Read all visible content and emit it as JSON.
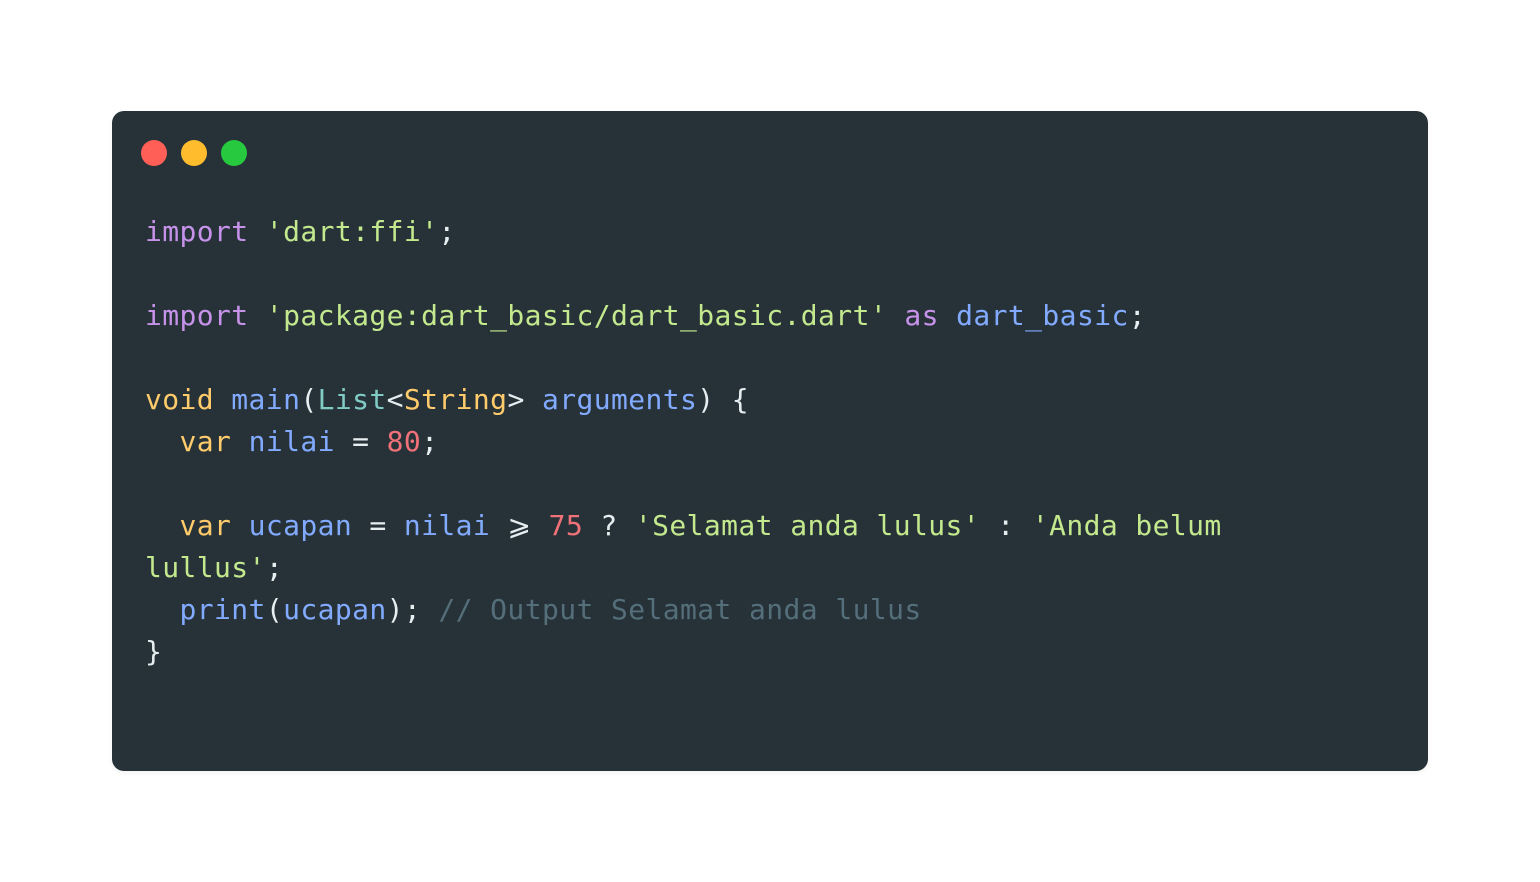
{
  "window": {
    "controls": {
      "close_color": "#ff5f56",
      "minimize_color": "#ffbd2e",
      "maximize_color": "#27c93f"
    }
  },
  "code": {
    "lines": [
      {
        "tokens": [
          {
            "text": "import",
            "kind": "kw"
          },
          {
            "text": " ",
            "kind": "op"
          },
          {
            "text": "'dart:ffi'",
            "kind": "str"
          },
          {
            "text": ";",
            "kind": "op"
          }
        ]
      },
      {
        "tokens": []
      },
      {
        "tokens": [
          {
            "text": "import",
            "kind": "kw"
          },
          {
            "text": " ",
            "kind": "op"
          },
          {
            "text": "'package:dart_basic/dart_basic.dart'",
            "kind": "str"
          },
          {
            "text": " ",
            "kind": "op"
          },
          {
            "text": "as",
            "kind": "kw"
          },
          {
            "text": " ",
            "kind": "op"
          },
          {
            "text": "dart_basic",
            "kind": "var"
          },
          {
            "text": ";",
            "kind": "op"
          }
        ]
      },
      {
        "tokens": []
      },
      {
        "tokens": [
          {
            "text": "void",
            "kind": "type"
          },
          {
            "text": " ",
            "kind": "op"
          },
          {
            "text": "main",
            "kind": "fn"
          },
          {
            "text": "(",
            "kind": "op"
          },
          {
            "text": "List",
            "kind": "cls"
          },
          {
            "text": "<",
            "kind": "op"
          },
          {
            "text": "String",
            "kind": "type"
          },
          {
            "text": "> ",
            "kind": "op"
          },
          {
            "text": "arguments",
            "kind": "var"
          },
          {
            "text": ") {",
            "kind": "op"
          }
        ]
      },
      {
        "tokens": [
          {
            "text": "  ",
            "kind": "op"
          },
          {
            "text": "var",
            "kind": "type"
          },
          {
            "text": " ",
            "kind": "op"
          },
          {
            "text": "nilai",
            "kind": "var"
          },
          {
            "text": " = ",
            "kind": "op"
          },
          {
            "text": "80",
            "kind": "num"
          },
          {
            "text": ";",
            "kind": "op"
          }
        ]
      },
      {
        "tokens": []
      },
      {
        "tokens": [
          {
            "text": "  ",
            "kind": "op"
          },
          {
            "text": "var",
            "kind": "type"
          },
          {
            "text": " ",
            "kind": "op"
          },
          {
            "text": "ucapan",
            "kind": "var"
          },
          {
            "text": " = ",
            "kind": "op"
          },
          {
            "text": "nilai",
            "kind": "var"
          },
          {
            "text": " ⩾ ",
            "kind": "op"
          },
          {
            "text": "75",
            "kind": "num"
          },
          {
            "text": " ? ",
            "kind": "op"
          },
          {
            "text": "'Selamat anda lulus'",
            "kind": "str"
          },
          {
            "text": " : ",
            "kind": "op"
          },
          {
            "text": "'Anda belum",
            "kind": "str"
          }
        ]
      },
      {
        "tokens": [
          {
            "text": "lullus'",
            "kind": "str"
          },
          {
            "text": ";",
            "kind": "op"
          }
        ]
      },
      {
        "tokens": [
          {
            "text": "  ",
            "kind": "op"
          },
          {
            "text": "print",
            "kind": "fn"
          },
          {
            "text": "(",
            "kind": "op"
          },
          {
            "text": "ucapan",
            "kind": "var"
          },
          {
            "text": "); ",
            "kind": "op"
          },
          {
            "text": "// Output Selamat anda lulus",
            "kind": "com"
          }
        ]
      },
      {
        "tokens": [
          {
            "text": "}",
            "kind": "op"
          }
        ]
      }
    ]
  }
}
